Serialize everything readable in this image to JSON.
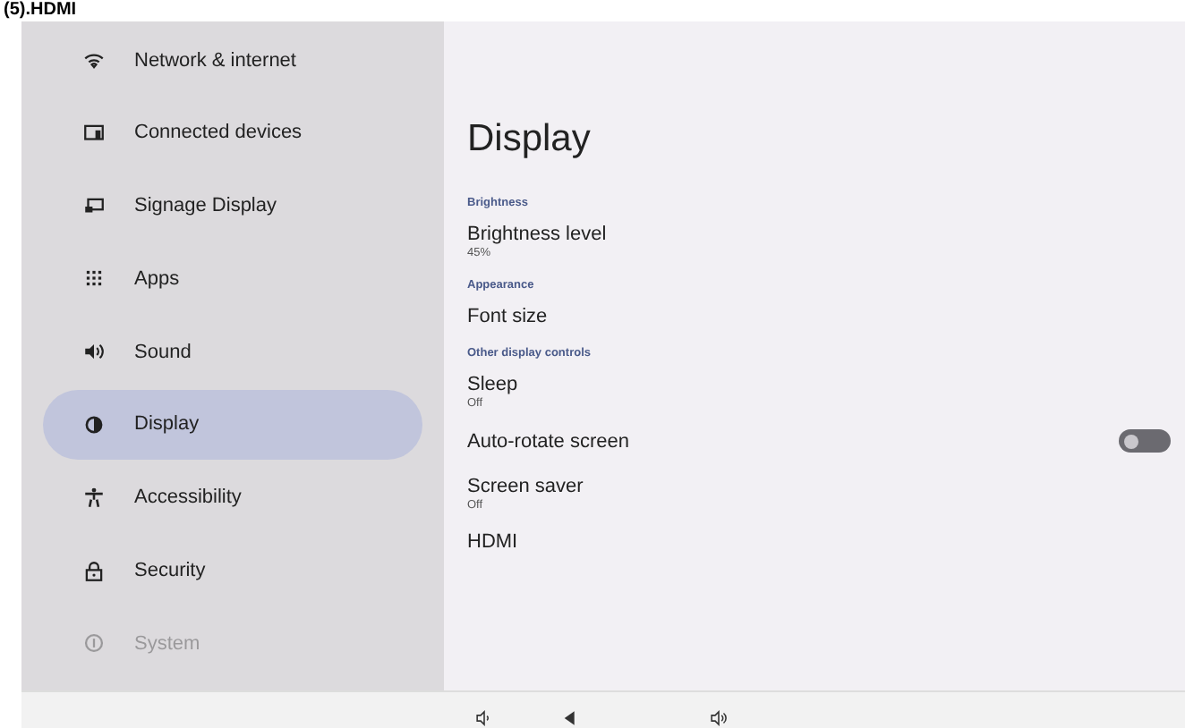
{
  "doc_caption": "(5).HDMI",
  "sidebar": {
    "items": [
      {
        "label": "Network & internet",
        "kind": "wifi",
        "selected": false,
        "disabled": false
      },
      {
        "label": "Connected devices",
        "kind": "devices",
        "selected": false,
        "disabled": false
      },
      {
        "label": "Signage Display",
        "kind": "signage",
        "selected": false,
        "disabled": false
      },
      {
        "label": "Apps",
        "kind": "apps",
        "selected": false,
        "disabled": false
      },
      {
        "label": "Sound",
        "kind": "sound",
        "selected": false,
        "disabled": false
      },
      {
        "label": "Display",
        "kind": "display",
        "selected": true,
        "disabled": false
      },
      {
        "label": "Accessibility",
        "kind": "accessibility",
        "selected": false,
        "disabled": false
      },
      {
        "label": "Security",
        "kind": "lock",
        "selected": false,
        "disabled": false
      },
      {
        "label": "System",
        "kind": "system",
        "selected": false,
        "disabled": true
      }
    ]
  },
  "page": {
    "title": "Display",
    "entries": [
      {
        "kind": "header",
        "label": "Brightness"
      },
      {
        "kind": "item",
        "label": "Brightness level",
        "summary": "45%"
      },
      {
        "kind": "header",
        "label": "Appearance"
      },
      {
        "kind": "item",
        "label": "Font size"
      },
      {
        "kind": "header",
        "label": "Other display controls"
      },
      {
        "kind": "item",
        "label": "Sleep",
        "summary": "Off"
      },
      {
        "kind": "switch",
        "label": "Auto-rotate screen",
        "on": false
      },
      {
        "kind": "item",
        "label": "Screen saver",
        "summary": "Off"
      },
      {
        "kind": "item",
        "label": "HDMI"
      }
    ]
  },
  "nav_bar": {
    "buttons": [
      {
        "kind": "volume-down"
      },
      {
        "kind": "back"
      },
      {
        "kind": "volume-up"
      }
    ]
  }
}
